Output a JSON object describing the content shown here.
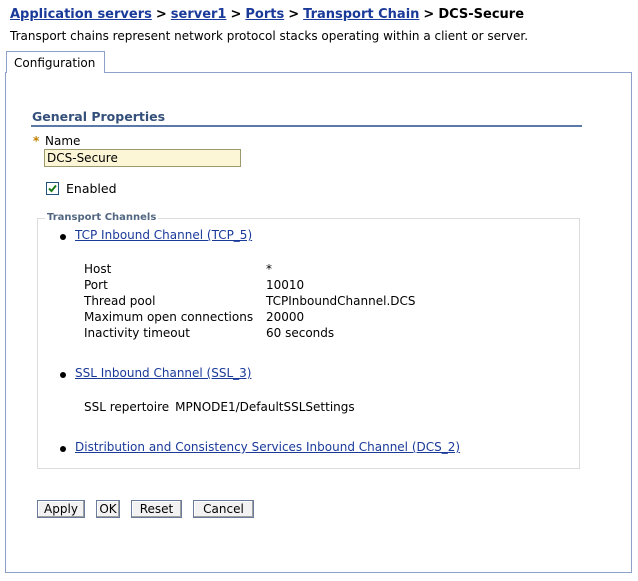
{
  "breadcrumb": {
    "items": [
      "Application servers",
      "server1",
      "Ports",
      "Transport Chain"
    ],
    "separator": ">",
    "current": "DCS-Secure"
  },
  "description": "Transport chains represent network protocol stacks operating within a client or server.",
  "tabs": [
    {
      "label": "Configuration",
      "active": true
    }
  ],
  "general_properties": {
    "title": "General Properties",
    "required_marker": "*",
    "name_label": "Name",
    "name_value": "DCS-Secure",
    "enabled_label": "Enabled",
    "enabled_checked": true
  },
  "transport_channels": {
    "legend": "Transport Channels",
    "tcp": {
      "link": "TCP Inbound Channel (TCP_5)",
      "properties": [
        {
          "label": "Host",
          "value": "*"
        },
        {
          "label": "Port",
          "value": "10010"
        },
        {
          "label": "Thread pool",
          "value": "TCPInboundChannel.DCS"
        },
        {
          "label": "Maximum open connections",
          "value": "20000"
        },
        {
          "label": "Inactivity timeout",
          "value": "60 seconds"
        }
      ]
    },
    "ssl": {
      "link": "SSL Inbound Channel (SSL_3)",
      "repertoire_label": "SSL repertoire",
      "repertoire_value": "MPNODE1/DefaultSSLSettings"
    },
    "dcs": {
      "link": "Distribution and Consistency Services Inbound Channel (DCS_2)"
    }
  },
  "buttons": {
    "apply": "Apply",
    "ok": "OK",
    "reset": "Reset",
    "cancel": "Cancel"
  },
  "colors": {
    "link": "#1a3a9a",
    "section_title": "#34507a",
    "input_bg": "#fdf6d6",
    "required_marker": "#c08000"
  }
}
